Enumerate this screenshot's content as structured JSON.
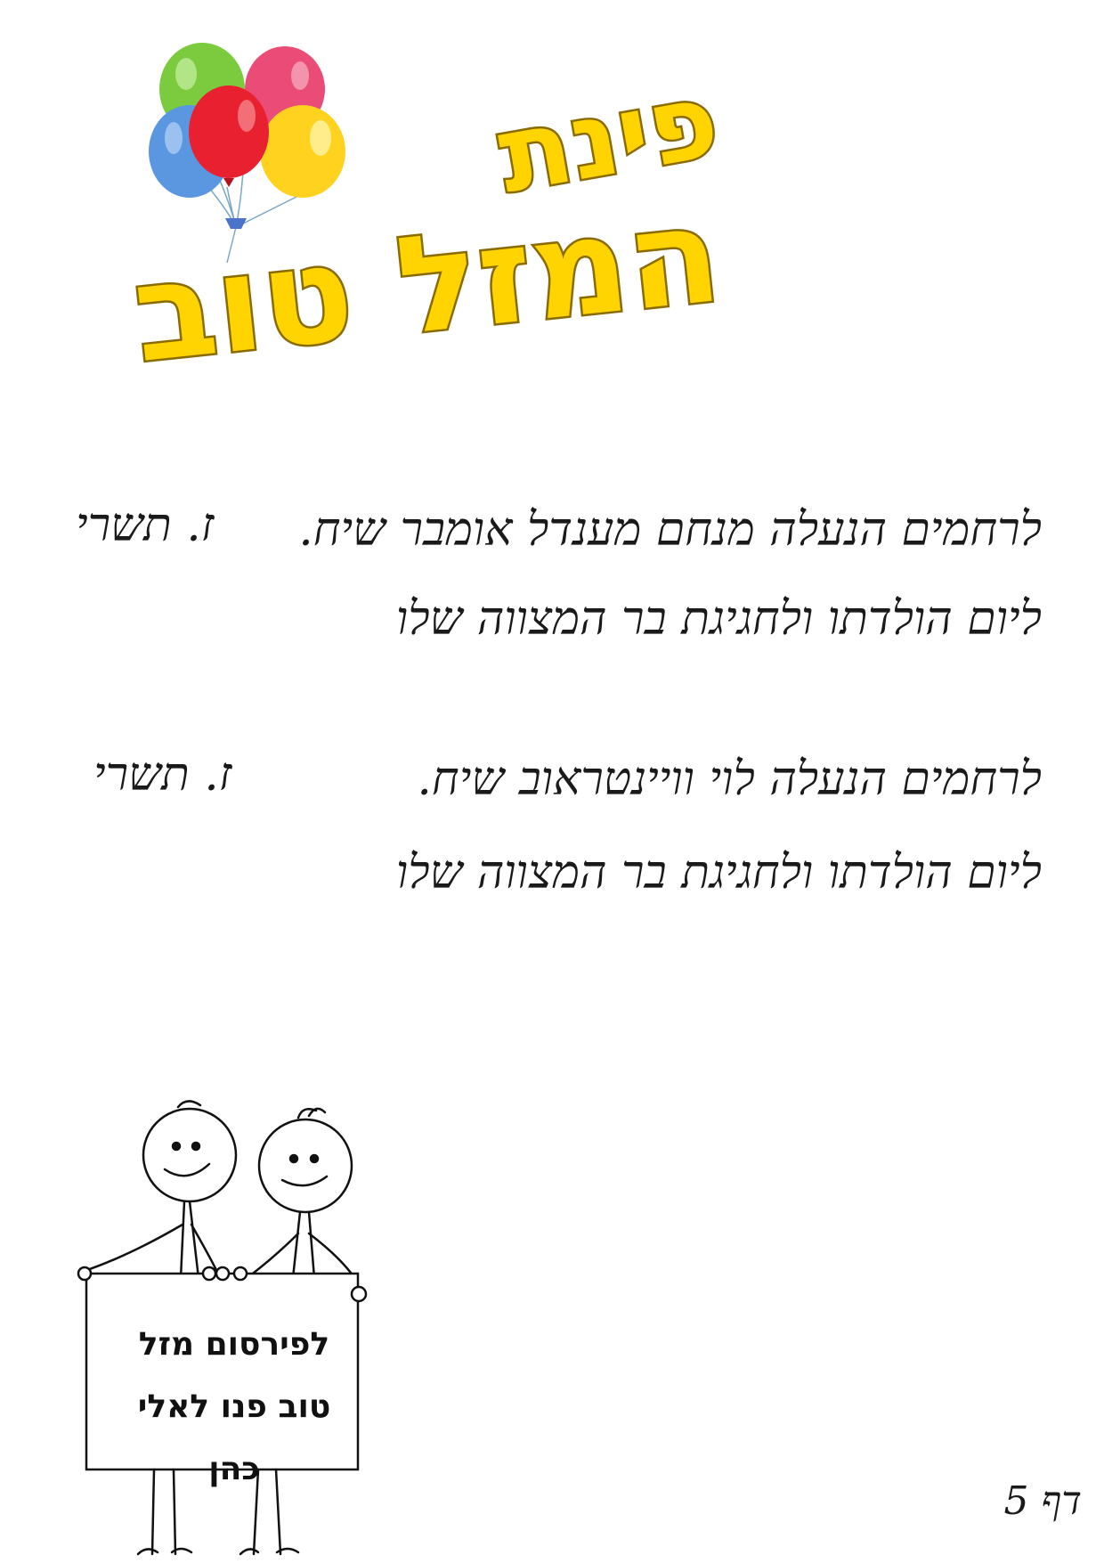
{
  "header": {
    "title_top": "פינת",
    "title_bottom": "המזל טוב",
    "balloon_colors": [
      "#7ccb3f",
      "#ea4b77",
      "#5b96e0",
      "#e8202f",
      "#ffd21f"
    ]
  },
  "greetings": [
    {
      "line1": "לרחמים הנעלה מנחם מענדל אומבר שיח.",
      "date": "ז. תשרי",
      "line2": "ליום הולדתו ולחגיגת בר המצווה שלו"
    },
    {
      "line1": "לרחמים הנעלה לוי וויינטראוב שיח.",
      "date": "ז. תשרי",
      "line2": "ליום הולדתו ולחגיגת בר המצווה שלו"
    }
  ],
  "sign": {
    "line1": "לפירסום מזל",
    "line2": "טוב פנו לאלי",
    "line3": "כהן"
  },
  "page_number": "דף 5"
}
